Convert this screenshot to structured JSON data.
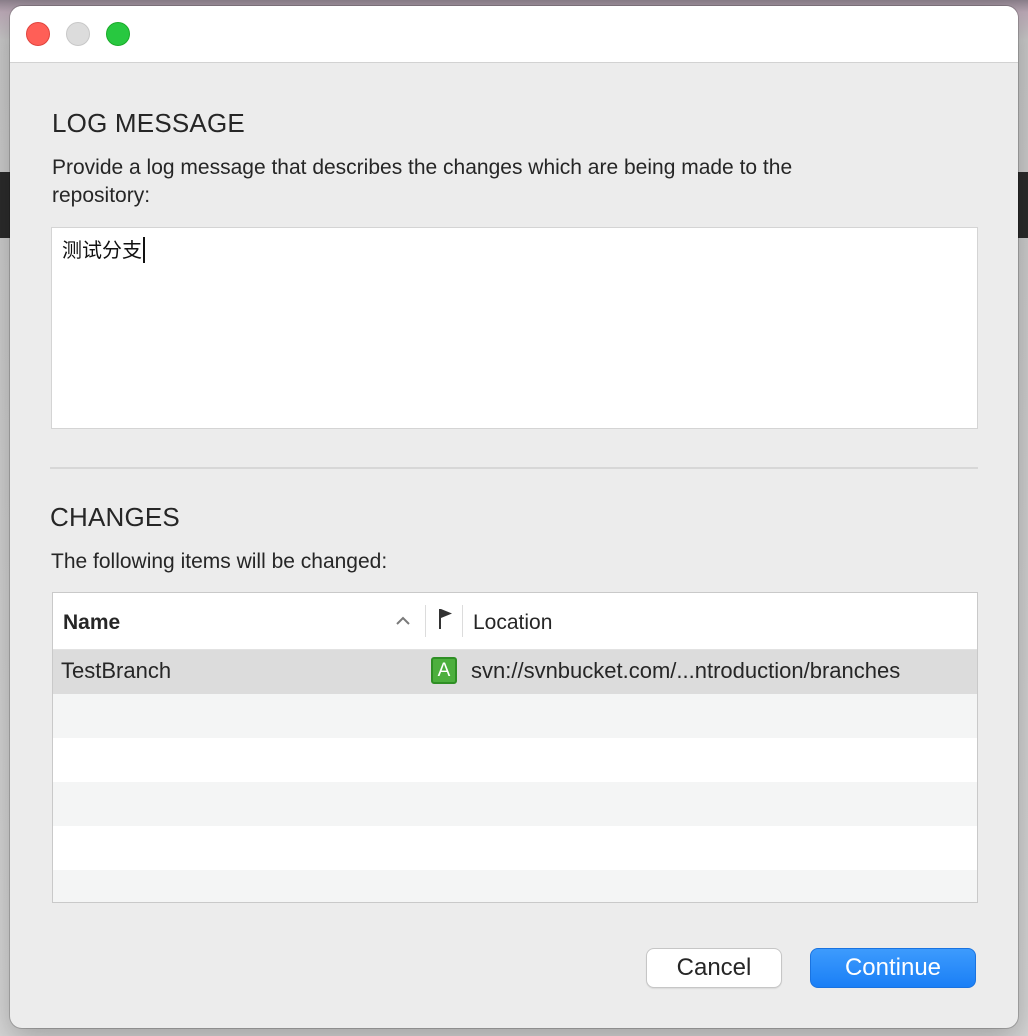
{
  "dialog": {
    "log_section": {
      "title": "LOG MESSAGE",
      "description_line1": "Provide a log message that describes the changes which are being made to the",
      "description_line2": "repository:",
      "message_value": "测试分支"
    },
    "changes_section": {
      "title": "CHANGES",
      "description": "The following items will be changed:",
      "columns": {
        "name": "Name",
        "status": "flag-icon",
        "location": "Location"
      },
      "rows": [
        {
          "name": "TestBranch",
          "status": "A",
          "location": "svn://svnbucket.com/...ntroduction/branches"
        }
      ]
    },
    "buttons": {
      "cancel": "Cancel",
      "continue": "Continue"
    }
  },
  "colors": {
    "accent": "#1a7ff6",
    "added_badge": "#4caf3d",
    "close": "#ff5f57",
    "maximize": "#28c840"
  }
}
